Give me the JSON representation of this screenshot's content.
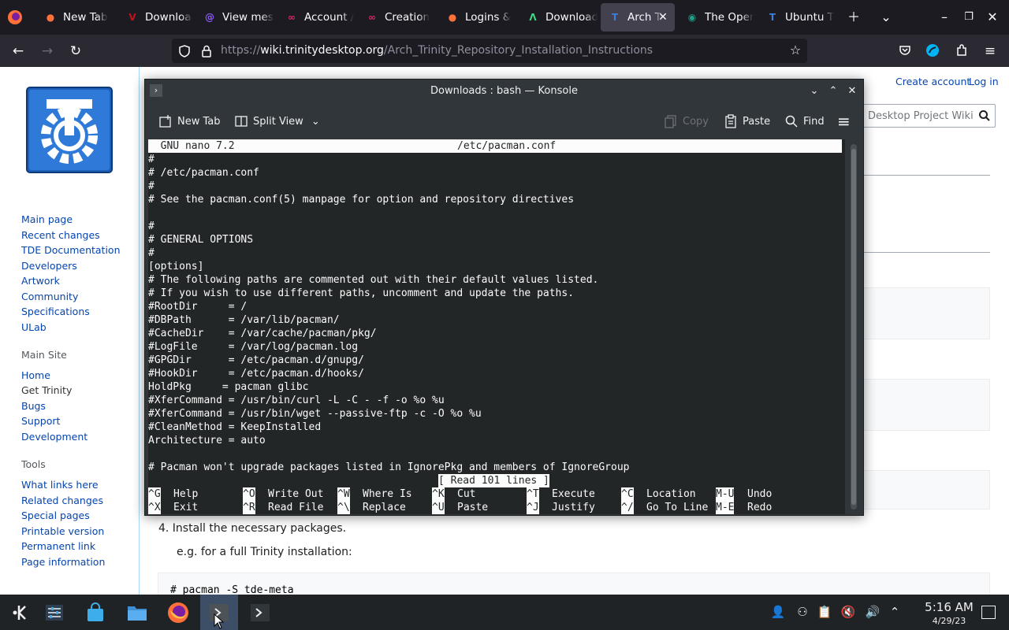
{
  "browser": {
    "tabs": [
      {
        "label": "New Tab",
        "icon": "firefox-icon"
      },
      {
        "label": "Downloads",
        "icon": "vivaldi-icon"
      },
      {
        "label": "View messages",
        "icon": "proton-mail-icon"
      },
      {
        "label": "Account /",
        "icon": "account-icon"
      },
      {
        "label": "Creation",
        "icon": "creation-icon"
      },
      {
        "label": "Logins &",
        "icon": "firefox-icon"
      },
      {
        "label": "Downloads",
        "icon": "android-icon"
      },
      {
        "label": "Arch Tr",
        "icon": "trinity-icon"
      },
      {
        "label": "The Oper",
        "icon": "opera-icon"
      },
      {
        "label": "Ubuntu T",
        "icon": "trinity-icon"
      }
    ],
    "url_prefix": "https://",
    "url_host": "wiki.trinitydesktop.org",
    "url_path": "/Arch_Trinity_Repository_Installation_Instructions"
  },
  "wiki": {
    "personal": {
      "create_account": "Create account",
      "login": "Log in"
    },
    "search_placeholder": "Desktop Project Wiki",
    "nav_links": [
      "Main page",
      "Recent changes",
      "TDE Documentation",
      "Developers",
      "Artwork",
      "Community",
      "Specifications",
      "ULab"
    ],
    "main_site_heading": "Main Site",
    "main_site_links": [
      "Home",
      "Get Trinity",
      "Bugs",
      "Support",
      "Development"
    ],
    "tools_heading": "Tools",
    "tools_links": [
      "What links here",
      "Related changes",
      "Special pages",
      "Printable version",
      "Permanent link",
      "Page information"
    ],
    "step4": "4. Install the necessary packages.",
    "example": "e.g. for a full Trinity installation:",
    "code": "# pacman -S tde-meta"
  },
  "konsole": {
    "title": "Downloads : bash — Konsole",
    "toolbar": {
      "new_tab": "New Tab",
      "split_view": "Split View",
      "copy": "Copy",
      "paste": "Paste",
      "find": "Find"
    },
    "nano_header_left": "  GNU nano 7.2",
    "nano_header_file": "/etc/pacman.conf",
    "lines": [
      "#",
      "# /etc/pacman.conf",
      "#",
      "# See the pacman.conf(5) manpage for option and repository directives",
      "",
      "#",
      "# GENERAL OPTIONS",
      "#",
      "[options]",
      "# The following paths are commented out with their default values listed.",
      "# If you wish to use different paths, uncomment and update the paths.",
      "#RootDir     = /",
      "#DBPath      = /var/lib/pacman/",
      "#CacheDir    = /var/cache/pacman/pkg/",
      "#LogFile     = /var/log/pacman.log",
      "#GPGDir      = /etc/pacman.d/gnupg/",
      "#HookDir     = /etc/pacman.d/hooks/",
      "HoldPkg     = pacman glibc",
      "#XferCommand = /usr/bin/curl -L -C - -f -o %o %u",
      "#XferCommand = /usr/bin/wget --passive-ftp -c -O %o %u",
      "#CleanMethod = KeepInstalled",
      "Architecture = auto",
      "",
      "# Pacman won't upgrade packages listed in IgnorePkg and members of IgnoreGroup"
    ],
    "status": "[ Read 101 lines ]",
    "shortcuts_row1": [
      {
        "key": "^G",
        "label": "Help"
      },
      {
        "key": "^O",
        "label": "Write Out"
      },
      {
        "key": "^W",
        "label": "Where Is"
      },
      {
        "key": "^K",
        "label": "Cut"
      },
      {
        "key": "^T",
        "label": "Execute"
      },
      {
        "key": "^C",
        "label": "Location"
      },
      {
        "key": "M-U",
        "label": "Undo"
      }
    ],
    "shortcuts_row2": [
      {
        "key": "^X",
        "label": "Exit"
      },
      {
        "key": "^R",
        "label": "Read File"
      },
      {
        "key": "^\\",
        "label": "Replace"
      },
      {
        "key": "^U",
        "label": "Paste"
      },
      {
        "key": "^J",
        "label": "Justify"
      },
      {
        "key": "^/",
        "label": "Go To Line"
      },
      {
        "key": "M-E",
        "label": "Redo"
      }
    ]
  },
  "taskbar": {
    "time": "5:16 AM",
    "date": "4/29/23"
  },
  "colors": {
    "firefox_tabbar": "#1c1b22",
    "firefox_toolbar": "#2b2a33",
    "wiki_link": "#0645ad",
    "konsole_bg": "#31363b",
    "terminal_bg": "#232627",
    "taskbar_bg": "#202326"
  }
}
